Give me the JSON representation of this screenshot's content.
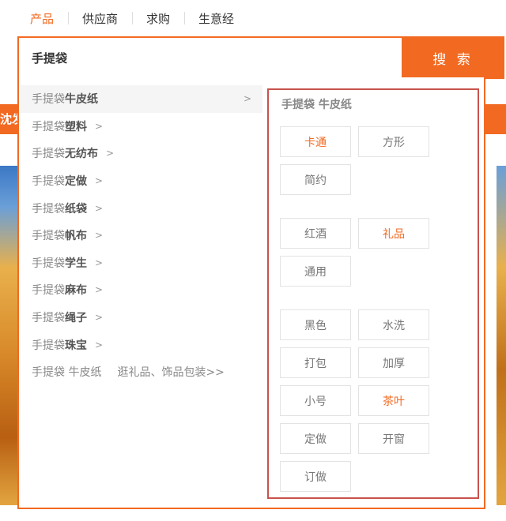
{
  "tabs": [
    "产品",
    "供应商",
    "求购",
    "生意经"
  ],
  "search": {
    "value": "手提袋",
    "button_label": "搜 索"
  },
  "background": {
    "banner_text": "沈发"
  },
  "suggestions": [
    {
      "kw": "手提袋 ",
      "hl": "牛皮纸",
      "arrow": ">",
      "extra": ""
    },
    {
      "kw": "手提袋 ",
      "hl": "塑料",
      "arrow": ">",
      "extra": ""
    },
    {
      "kw": "手提袋 ",
      "hl": "无纺布",
      "arrow": ">",
      "extra": ""
    },
    {
      "kw": "手提袋",
      "hl": "定做",
      "arrow": ">",
      "extra": ""
    },
    {
      "kw": "手提袋",
      "hl": "纸袋",
      "arrow": ">",
      "extra": ""
    },
    {
      "kw": "手提袋 ",
      "hl": "帆布",
      "arrow": ">",
      "extra": ""
    },
    {
      "kw": "手提袋 ",
      "hl": "学生",
      "arrow": ">",
      "extra": ""
    },
    {
      "kw": "手提袋 ",
      "hl": "麻布",
      "arrow": ">",
      "extra": ""
    },
    {
      "kw": "手提袋",
      "hl": "绳子",
      "arrow": ">",
      "extra": ""
    },
    {
      "kw": "手提袋 ",
      "hl": "珠宝",
      "arrow": ">",
      "extra": ""
    },
    {
      "kw": "手提袋 牛皮纸",
      "hl": "",
      "arrow": "",
      "extra": "逛礼品、饰品包装>>"
    }
  ],
  "facet": {
    "title": "手提袋 牛皮纸",
    "groups": [
      [
        {
          "label": "卡通",
          "hot": true
        },
        {
          "label": "方形",
          "hot": false
        },
        {
          "label": "简约",
          "hot": false
        }
      ],
      [
        {
          "label": "红酒",
          "hot": false
        },
        {
          "label": "礼品",
          "hot": true
        },
        {
          "label": "通用",
          "hot": false
        }
      ],
      [
        {
          "label": "黑色",
          "hot": false
        },
        {
          "label": "水洗",
          "hot": false
        },
        {
          "label": "打包",
          "hot": false
        },
        {
          "label": "加厚",
          "hot": false
        },
        {
          "label": "小号",
          "hot": false
        },
        {
          "label": "茶叶",
          "hot": true
        },
        {
          "label": "定做",
          "hot": false
        },
        {
          "label": "开窗",
          "hot": false
        },
        {
          "label": "订做",
          "hot": false
        }
      ]
    ]
  },
  "colors": {
    "accent": "#f26a22",
    "facet_border": "#c9524d"
  }
}
